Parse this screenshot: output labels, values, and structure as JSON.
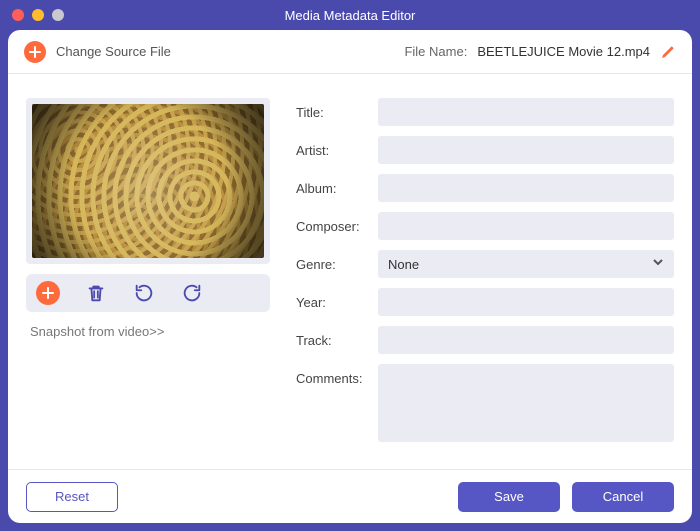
{
  "window": {
    "title": "Media Metadata Editor"
  },
  "topbar": {
    "change_label": "Change Source File",
    "file_label": "File Name:",
    "file_name": "BEETLEJUICE Movie 12.mp4"
  },
  "thumbnail": {
    "snapshot_link": "Snapshot from video>>"
  },
  "form": {
    "labels": {
      "title": "Title:",
      "artist": "Artist:",
      "album": "Album:",
      "composer": "Composer:",
      "genre": "Genre:",
      "year": "Year:",
      "track": "Track:",
      "comments": "Comments:"
    },
    "values": {
      "title": "",
      "artist": "",
      "album": "",
      "composer": "",
      "genre": "None",
      "year": "",
      "track": "",
      "comments": ""
    }
  },
  "footer": {
    "reset": "Reset",
    "save": "Save",
    "cancel": "Cancel"
  }
}
